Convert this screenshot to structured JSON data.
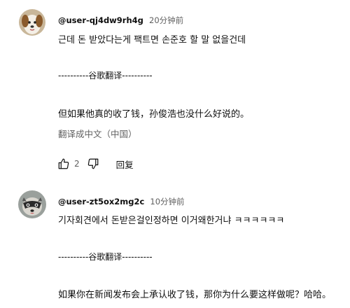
{
  "comments": [
    {
      "author": "@user-qj4dw9rh4g",
      "time": "20分钟前",
      "text": "근데 돈 받았다는게 팩트면 손준호 할 말 없을건데",
      "separator": "----------谷歌翻译----------",
      "translation": "但如果他真的收了钱，孙俊浩也没什么好说的。",
      "translate_label": "翻译成中文（中国）",
      "like_count": "2",
      "reply_label": "回复",
      "avatar_icon": "dog-avatar"
    },
    {
      "author": "@user-zt5ox2mg2c",
      "time": "10分钟前",
      "text": "기자회견에서 돈받은걸인정하면 이거왜한거냐 ㅋㅋㅋㅋㅋㅋ",
      "separator": "----------谷歌翻译----------",
      "translation": "如果你在新闻发布会上承认收了钱，那你为什么要这样做呢？哈哈。",
      "avatar_icon": "raccoon-avatar"
    }
  ],
  "icons": {
    "like": "thumbs-up-icon",
    "dislike": "thumbs-down-icon"
  }
}
